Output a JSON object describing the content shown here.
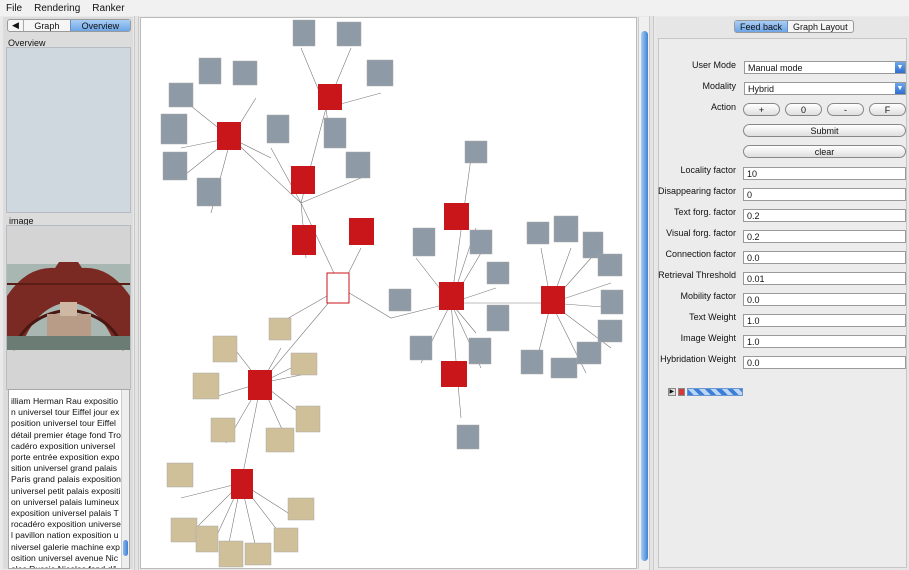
{
  "menu": [
    "File",
    "Rendering",
    "Ranker"
  ],
  "left": {
    "tabs": {
      "arrow": "◀",
      "graph": "Graph",
      "overview": "Overview"
    },
    "overview_label": "Overview",
    "image_label": "image",
    "description": "illiam Herman Rau exposition universel tour Eiffel jour exposition universel tour Eiffel détail premier étage fond Trocadéro exposition universel porte entrée exposition exposition universel grand palais Paris grand palais exposition universel petit palais exposition universel palais lumineux exposition universel palais Trocadéro exposition universel pavillon nation exposition universel galerie machine exposition universel avenue Nicolas Russie Nicolas fond dôme hôtel invalide"
  },
  "right": {
    "tabs": {
      "feedback": "Feed back",
      "layout": "Graph Layout"
    },
    "user_mode": {
      "label": "User Mode",
      "value": "Manual mode"
    },
    "modality": {
      "label": "Modality",
      "value": "Hybrid"
    },
    "action": {
      "label": "Action",
      "plus": "+",
      "zero": "0",
      "minus": "-",
      "f": "F"
    },
    "submit": "Submit",
    "clear": "clear",
    "params": [
      {
        "label": "Locality factor",
        "value": "10"
      },
      {
        "label": "Disappearing factor",
        "value": "0"
      },
      {
        "label": "Text forg. factor",
        "value": "0.2"
      },
      {
        "label": "Visual forg. factor",
        "value": "0.2"
      },
      {
        "label": "Connection factor",
        "value": "0.0"
      },
      {
        "label": "Retrieval Threshold",
        "value": "0.01"
      },
      {
        "label": "Mobility factor",
        "value": "0.0"
      },
      {
        "label": "Text Weight",
        "value": "1.0"
      },
      {
        "label": "Image Weight",
        "value": "1.0"
      },
      {
        "label": "Hybridation Weight",
        "value": "0.0"
      }
    ]
  },
  "colors": {
    "accent": "#3e82d6",
    "highlight": "#c8161b",
    "node_frame": "#d3d3d3"
  }
}
